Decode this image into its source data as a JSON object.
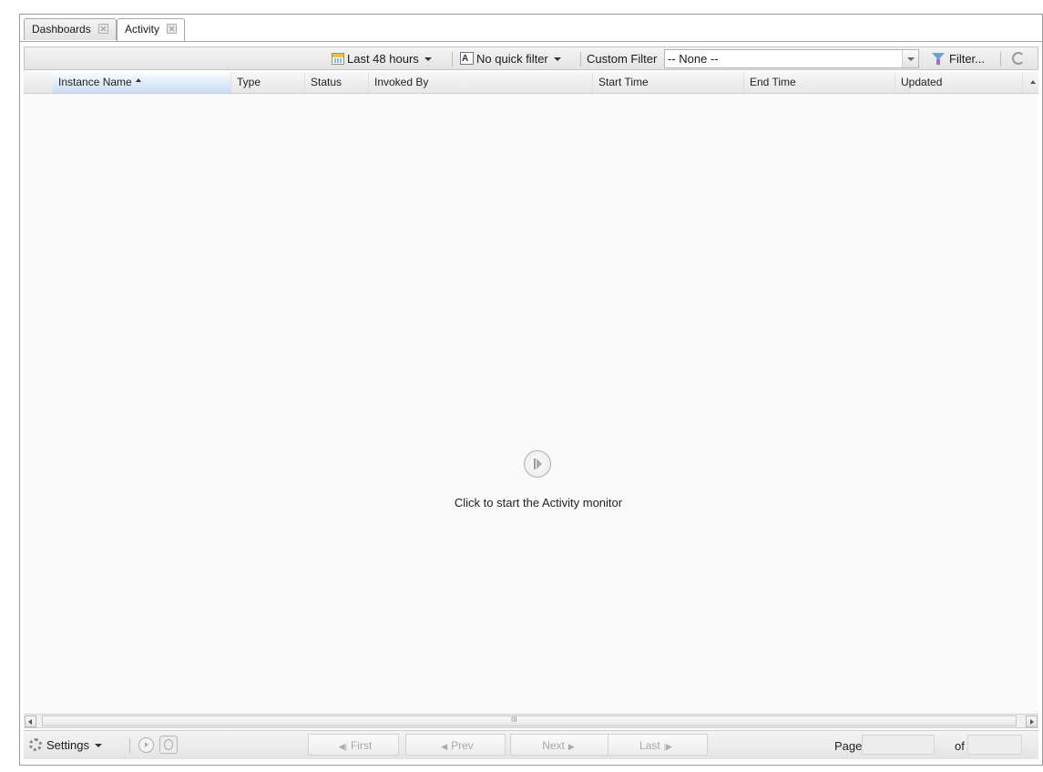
{
  "tabs": [
    {
      "label": "Dashboards",
      "active": false
    },
    {
      "label": "Activity",
      "active": true
    }
  ],
  "toolbar": {
    "time_range": "Last 48 hours",
    "quick_filter": "No quick filter",
    "custom_filter_label": "Custom Filter",
    "custom_filter_value": "-- None --",
    "filter_button": "Filter..."
  },
  "columns": [
    {
      "label": "Instance Name",
      "sorted": "asc"
    },
    {
      "label": "Type"
    },
    {
      "label": "Status"
    },
    {
      "label": "Invoked By"
    },
    {
      "label": "Start Time"
    },
    {
      "label": "End Time"
    },
    {
      "label": "Updated"
    }
  ],
  "empty_state": {
    "message": "Click to start the Activity monitor"
  },
  "scrollbar": {
    "grip": "III"
  },
  "bottom": {
    "settings_label": "Settings",
    "pager": {
      "first": "First",
      "prev": "Prev",
      "next": "Next",
      "last": "Last",
      "page_label": "Page",
      "of_label": "of"
    }
  },
  "colors": {
    "accent": "#c9dcf3",
    "background": "#fafafa",
    "border": "#9a9a9a"
  }
}
